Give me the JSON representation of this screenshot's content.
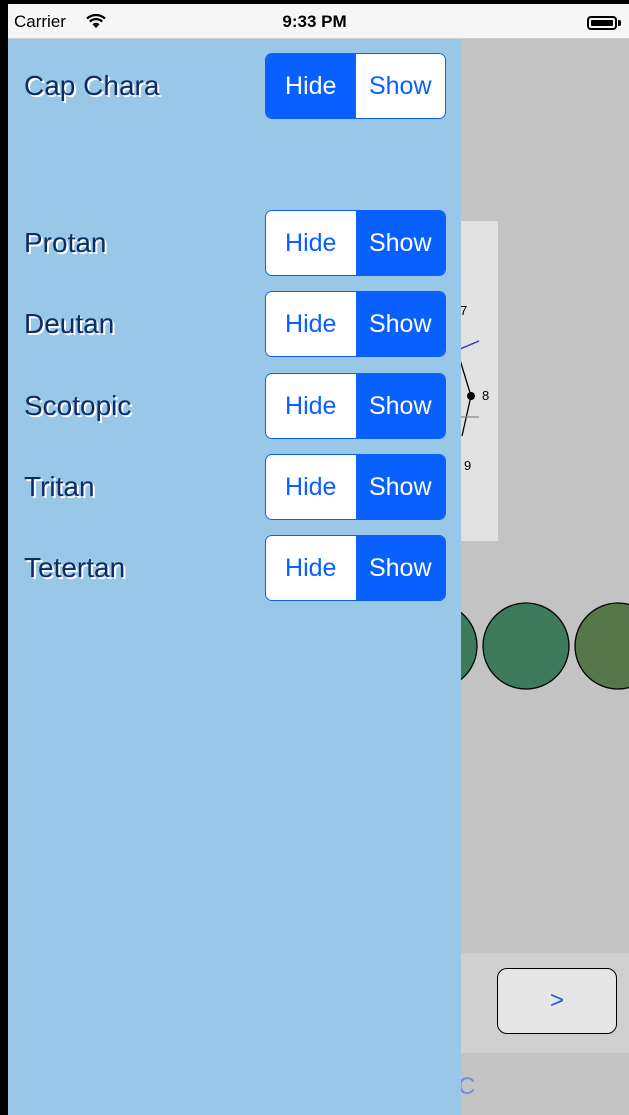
{
  "status_bar": {
    "carrier": "Carrier",
    "time": "9:33 PM"
  },
  "background": {
    "cap_numbers": [
      "7",
      "8",
      "9"
    ],
    "next_button_label": ">",
    "under_text": "C",
    "cap_colors": [
      "#3d7a5c",
      "#3d7a5c",
      "#55774a"
    ]
  },
  "panel": {
    "rows": [
      {
        "label": "Cap Chara",
        "hide": "Hide",
        "show": "Show",
        "selected": "Hide"
      },
      {
        "label": "Protan",
        "hide": "Hide",
        "show": "Show",
        "selected": "Show"
      },
      {
        "label": "Deutan",
        "hide": "Hide",
        "show": "Show",
        "selected": "Show"
      },
      {
        "label": "Scotopic",
        "hide": "Hide",
        "show": "Show",
        "selected": "Show"
      },
      {
        "label": "Tritan",
        "hide": "Hide",
        "show": "Show",
        "selected": "Show"
      },
      {
        "label": "Tetertan",
        "hide": "Hide",
        "show": "Show",
        "selected": "Show"
      }
    ]
  },
  "colors": {
    "panel_bg": "#99c7e7",
    "accent": "#0a60ff",
    "label_text": "#0c2d63"
  }
}
